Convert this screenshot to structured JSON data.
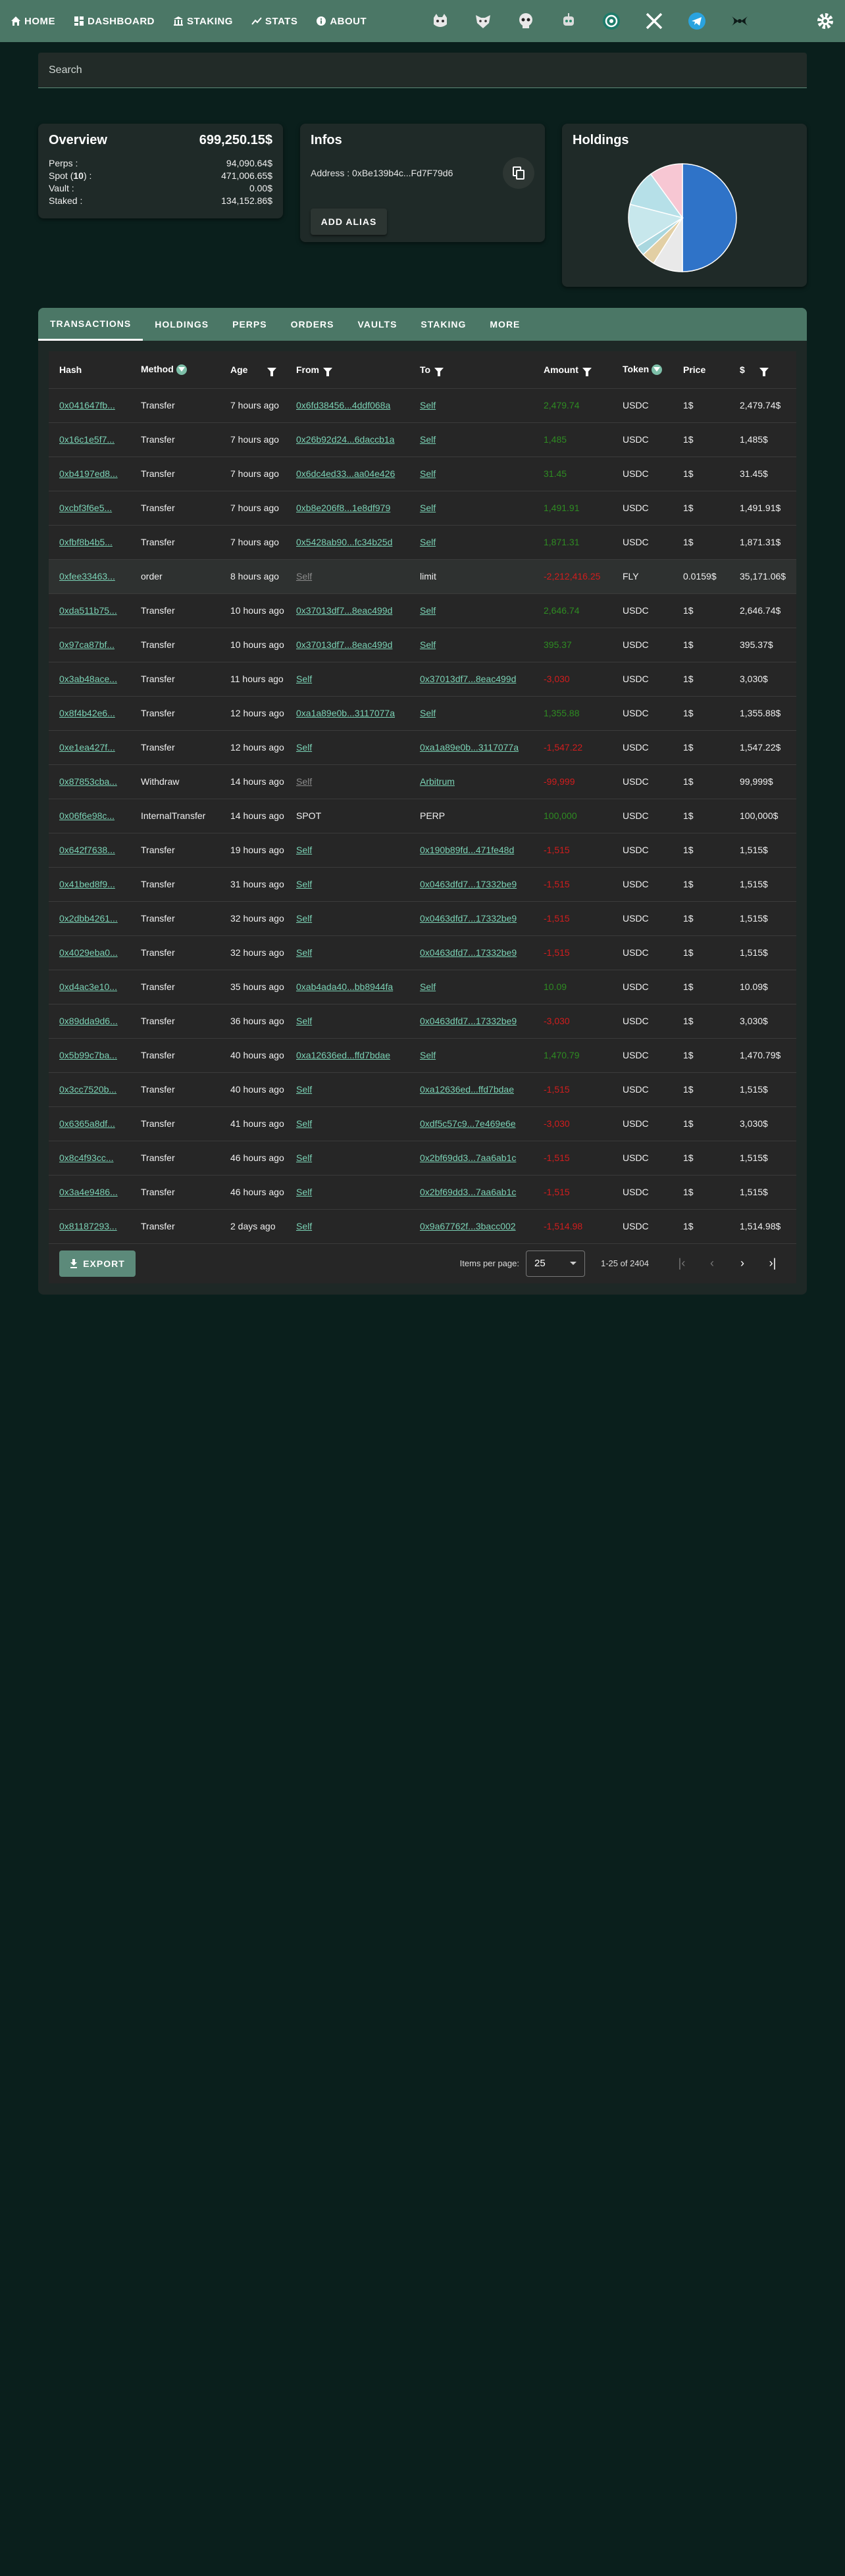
{
  "nav": {
    "items": [
      {
        "label": "HOME",
        "icon": "home-icon"
      },
      {
        "label": "DASHBOARD",
        "icon": "dashboard-icon"
      },
      {
        "label": "STAKING",
        "icon": "bank-icon"
      },
      {
        "label": "STATS",
        "icon": "chart-icon"
      },
      {
        "label": "ABOUT",
        "icon": "info-icon"
      }
    ],
    "social_icons": [
      "cat-icon",
      "wolf-icon",
      "skull-icon",
      "robot-icon",
      "circle-logo-icon",
      "x-icon",
      "telegram-icon",
      "bow-icon"
    ],
    "settings_icon": "gear-icon"
  },
  "search": {
    "placeholder": "Search"
  },
  "overview": {
    "title": "Overview",
    "total": "699,250.15$",
    "rows": [
      {
        "label": "Perps :",
        "value": "94,090.64$"
      },
      {
        "label_prefix": "Spot (",
        "label_bold": "10",
        "label_suffix": ") :",
        "value": "471,006.65$"
      },
      {
        "label": "Vault :",
        "value": "0.00$"
      },
      {
        "label": "Staked :",
        "value": "134,152.86$"
      }
    ]
  },
  "infos": {
    "title": "Infos",
    "address": "Address : 0xBe139b4c...Fd7F79d6",
    "alias_button": "ADD ALIAS"
  },
  "holdings": {
    "title": "Holdings"
  },
  "chart_data": {
    "type": "pie",
    "title": "Holdings",
    "values": [
      50,
      9,
      4,
      3,
      13,
      11,
      10
    ],
    "colors": [
      "#2f73c8",
      "#e9e9e9",
      "#e2cfa4",
      "#a9d7df",
      "#c7e7ec",
      "#b6e0e8",
      "#f7c7d3"
    ]
  },
  "tabs": [
    "TRANSACTIONS",
    "HOLDINGS",
    "PERPS",
    "ORDERS",
    "VAULTS",
    "STAKING",
    "MORE"
  ],
  "table": {
    "headers": {
      "hash": "Hash",
      "method": "Method",
      "age": "Age",
      "from": "From",
      "to": "To",
      "amount": "Amount",
      "token": "Token",
      "price": "Price",
      "usd": "$"
    },
    "rows": [
      {
        "hash": "0x041647fb...",
        "method": "Transfer",
        "age": "7 hours ago",
        "from": "0x6fd38456...4ddf068a",
        "to": "Self",
        "amount": "2,479.74",
        "sign": "pos",
        "token": "USDC",
        "price": "1$",
        "usd": "2,479.74$"
      },
      {
        "hash": "0x16c1e5f7...",
        "method": "Transfer",
        "age": "7 hours ago",
        "from": "0x26b92d24...6daccb1a",
        "to": "Self",
        "amount": "1,485",
        "sign": "pos",
        "token": "USDC",
        "price": "1$",
        "usd": "1,485$"
      },
      {
        "hash": "0xb4197ed8...",
        "method": "Transfer",
        "age": "7 hours ago",
        "from": "0x6dc4ed33...aa04e426",
        "to": "Self",
        "amount": "31.45",
        "sign": "pos",
        "token": "USDC",
        "price": "1$",
        "usd": "31.45$"
      },
      {
        "hash": "0xcbf3f6e5...",
        "method": "Transfer",
        "age": "7 hours ago",
        "from": "0xb8e206f8...1e8df979",
        "to": "Self",
        "amount": "1,491.91",
        "sign": "pos",
        "token": "USDC",
        "price": "1$",
        "usd": "1,491.91$"
      },
      {
        "hash": "0xfbf8b4b5...",
        "method": "Transfer",
        "age": "7 hours ago",
        "from": "0x5428ab90...fc34b25d",
        "to": "Self",
        "amount": "1,871.31",
        "sign": "pos",
        "token": "USDC",
        "price": "1$",
        "usd": "1,871.31$"
      },
      {
        "hash": "0xfee33463...",
        "method": "order",
        "age": "8 hours ago",
        "from": "Self",
        "from_muted": true,
        "to": "limit",
        "to_plain": true,
        "amount": "-2,212,416.25",
        "sign": "neg",
        "token": "FLY",
        "price": "0.0159$",
        "usd": "35,171.06$",
        "highlight": true
      },
      {
        "hash": "0xda511b75...",
        "method": "Transfer",
        "age": "10 hours ago",
        "from": "0x37013df7...8eac499d",
        "to": "Self",
        "amount": "2,646.74",
        "sign": "pos",
        "token": "USDC",
        "price": "1$",
        "usd": "2,646.74$"
      },
      {
        "hash": "0x97ca87bf...",
        "method": "Transfer",
        "age": "10 hours ago",
        "from": "0x37013df7...8eac499d",
        "to": "Self",
        "amount": "395.37",
        "sign": "pos",
        "token": "USDC",
        "price": "1$",
        "usd": "395.37$"
      },
      {
        "hash": "0x3ab48ace...",
        "method": "Transfer",
        "age": "11 hours ago",
        "from": "Self",
        "to": "0x37013df7...8eac499d",
        "amount": "-3,030",
        "sign": "neg",
        "token": "USDC",
        "price": "1$",
        "usd": "3,030$"
      },
      {
        "hash": "0x8f4b42e6...",
        "method": "Transfer",
        "age": "12 hours ago",
        "from": "0xa1a89e0b...3117077a",
        "to": "Self",
        "amount": "1,355.88",
        "sign": "pos",
        "token": "USDC",
        "price": "1$",
        "usd": "1,355.88$"
      },
      {
        "hash": "0xe1ea427f...",
        "method": "Transfer",
        "age": "12 hours ago",
        "from": "Self",
        "to": "0xa1a89e0b...3117077a",
        "amount": "-1,547.22",
        "sign": "neg",
        "token": "USDC",
        "price": "1$",
        "usd": "1,547.22$"
      },
      {
        "hash": "0x87853cba...",
        "method": "Withdraw",
        "age": "14 hours ago",
        "from": "Self",
        "from_muted": true,
        "to": "Arbitrum",
        "amount": "-99,999",
        "sign": "neg",
        "token": "USDC",
        "price": "1$",
        "usd": "99,999$"
      },
      {
        "hash": "0x06f6e98c...",
        "method": "InternalTransfer",
        "age": "14 hours ago",
        "from": "SPOT",
        "from_plain": true,
        "to": "PERP",
        "to_plain": true,
        "amount": "100,000",
        "sign": "pos",
        "token": "USDC",
        "price": "1$",
        "usd": "100,000$"
      },
      {
        "hash": "0x642f7638...",
        "method": "Transfer",
        "age": "19 hours ago",
        "from": "Self",
        "to": "0x190b89fd...471fe48d",
        "amount": "-1,515",
        "sign": "neg",
        "token": "USDC",
        "price": "1$",
        "usd": "1,515$"
      },
      {
        "hash": "0x41bed8f9...",
        "method": "Transfer",
        "age": "31 hours ago",
        "from": "Self",
        "to": "0x0463dfd7...17332be9",
        "amount": "-1,515",
        "sign": "neg",
        "token": "USDC",
        "price": "1$",
        "usd": "1,515$"
      },
      {
        "hash": "0x2dbb4261...",
        "method": "Transfer",
        "age": "32 hours ago",
        "from": "Self",
        "to": "0x0463dfd7...17332be9",
        "amount": "-1,515",
        "sign": "neg",
        "token": "USDC",
        "price": "1$",
        "usd": "1,515$"
      },
      {
        "hash": "0x4029eba0...",
        "method": "Transfer",
        "age": "32 hours ago",
        "from": "Self",
        "to": "0x0463dfd7...17332be9",
        "amount": "-1,515",
        "sign": "neg",
        "token": "USDC",
        "price": "1$",
        "usd": "1,515$"
      },
      {
        "hash": "0xd4ac3e10...",
        "method": "Transfer",
        "age": "35 hours ago",
        "from": "0xab4ada40...bb8944fa",
        "to": "Self",
        "amount": "10.09",
        "sign": "pos",
        "token": "USDC",
        "price": "1$",
        "usd": "10.09$"
      },
      {
        "hash": "0x89dda9d6...",
        "method": "Transfer",
        "age": "36 hours ago",
        "from": "Self",
        "to": "0x0463dfd7...17332be9",
        "amount": "-3,030",
        "sign": "neg",
        "token": "USDC",
        "price": "1$",
        "usd": "3,030$"
      },
      {
        "hash": "0x5b99c7ba...",
        "method": "Transfer",
        "age": "40 hours ago",
        "from": "0xa12636ed...ffd7bdae",
        "to": "Self",
        "amount": "1,470.79",
        "sign": "pos",
        "token": "USDC",
        "price": "1$",
        "usd": "1,470.79$"
      },
      {
        "hash": "0x3cc7520b...",
        "method": "Transfer",
        "age": "40 hours ago",
        "from": "Self",
        "to": "0xa12636ed...ffd7bdae",
        "amount": "-1,515",
        "sign": "neg",
        "token": "USDC",
        "price": "1$",
        "usd": "1,515$"
      },
      {
        "hash": "0x6365a8df...",
        "method": "Transfer",
        "age": "41 hours ago",
        "from": "Self",
        "to": "0xdf5c57c9...7e469e6e",
        "amount": "-3,030",
        "sign": "neg",
        "token": "USDC",
        "price": "1$",
        "usd": "3,030$"
      },
      {
        "hash": "0x8c4f93cc...",
        "method": "Transfer",
        "age": "46 hours ago",
        "from": "Self",
        "to": "0x2bf69dd3...7aa6ab1c",
        "amount": "-1,515",
        "sign": "neg",
        "token": "USDC",
        "price": "1$",
        "usd": "1,515$"
      },
      {
        "hash": "0x3a4e9486...",
        "method": "Transfer",
        "age": "46 hours ago",
        "from": "Self",
        "to": "0x2bf69dd3...7aa6ab1c",
        "amount": "-1,515",
        "sign": "neg",
        "token": "USDC",
        "price": "1$",
        "usd": "1,515$"
      },
      {
        "hash": "0x81187293...",
        "method": "Transfer",
        "age": "2 days ago",
        "from": "Self",
        "to": "0x9a67762f...3bacc002",
        "amount": "-1,514.98",
        "sign": "neg",
        "token": "USDC",
        "price": "1$",
        "usd": "1,514.98$"
      }
    ]
  },
  "footer": {
    "export_label": "EXPORT",
    "items_per_page_label": "Items per page:",
    "items_per_page": "25",
    "range": "1-25 of 2404"
  }
}
